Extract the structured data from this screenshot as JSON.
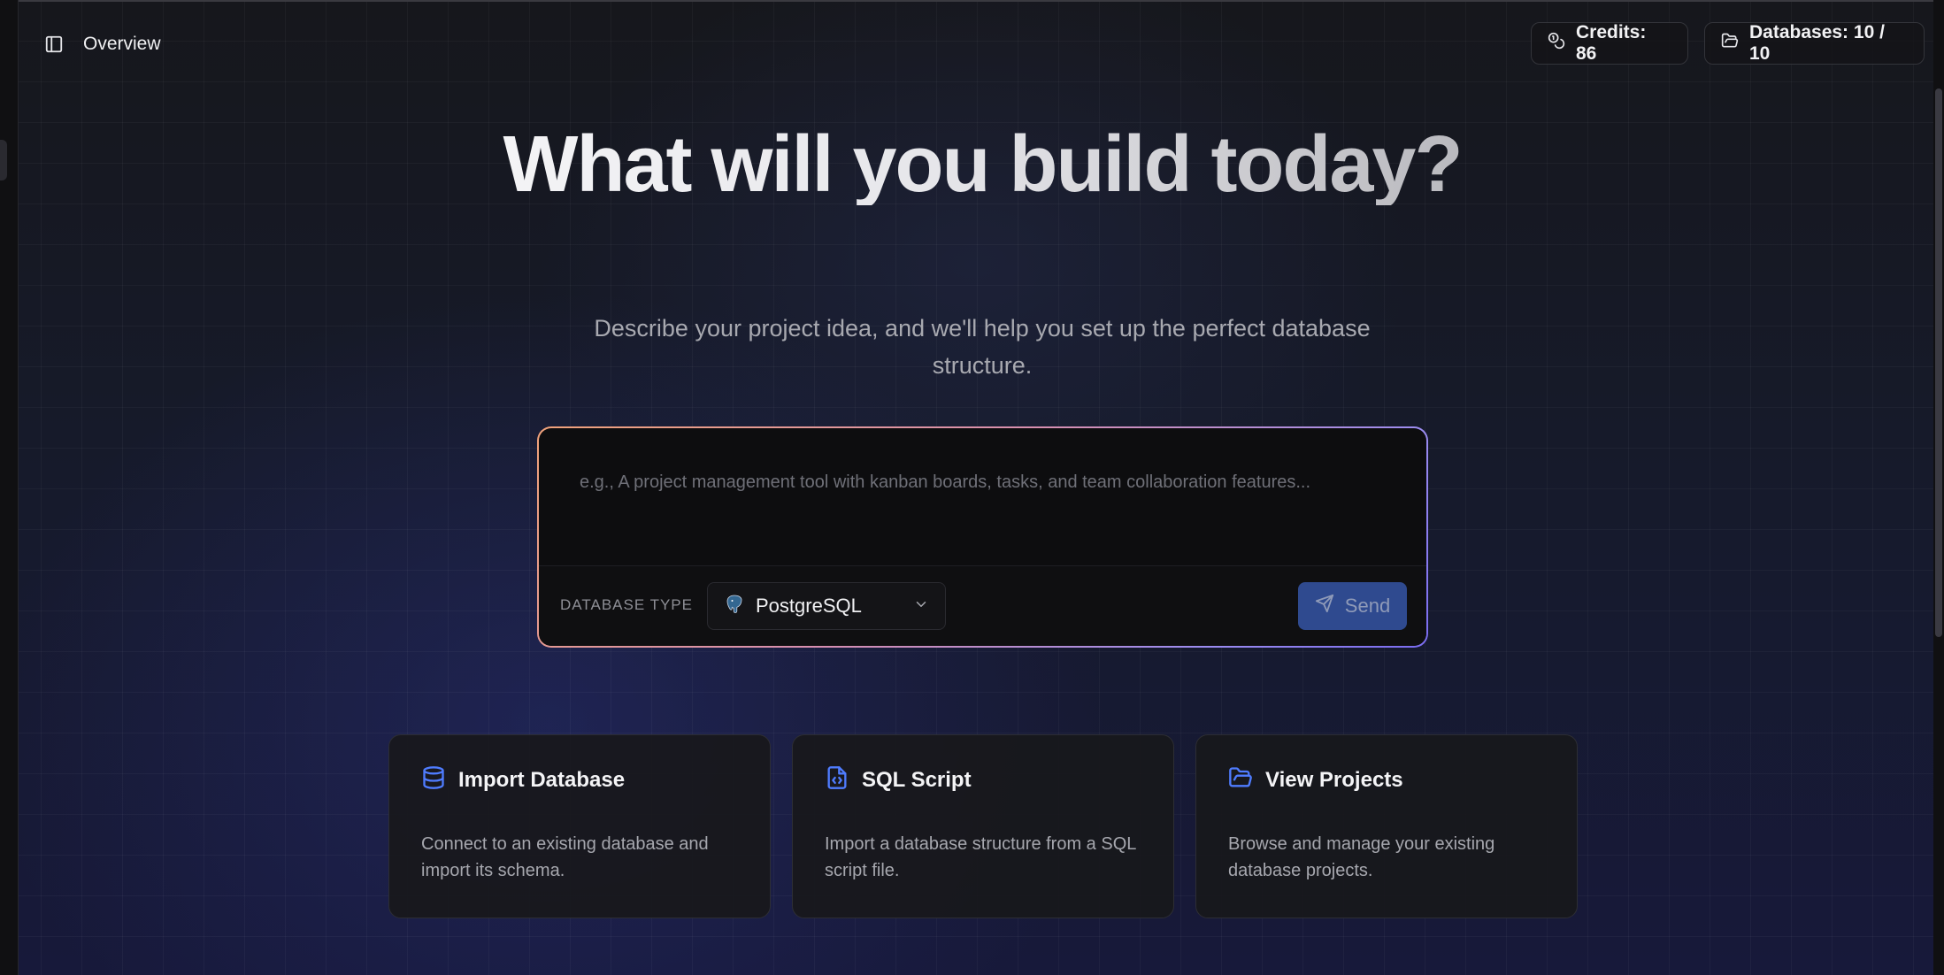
{
  "header": {
    "sidebar_toggle_icon": "sidebar-toggle-icon",
    "title": "Overview",
    "credits_label": "Credits: 86",
    "databases_label": "Databases: 10 / 10"
  },
  "hero": {
    "title": "What will you build today?",
    "subtitle": "Describe your project idea, and we'll help you set up the perfect database structure."
  },
  "prompt": {
    "placeholder": "e.g., A project management tool with kanban boards, tasks, and team collaboration features...",
    "database_type_label": "DATABASE TYPE",
    "database_type_value": "PostgreSQL",
    "send_label": "Send"
  },
  "cards": [
    {
      "icon": "database-icon",
      "title": "Import Database",
      "description": "Connect to an existing database and import its schema."
    },
    {
      "icon": "file-code-icon",
      "title": "SQL Script",
      "description": "Import a database structure from a SQL script file."
    },
    {
      "icon": "folder-open-icon",
      "title": "View Projects",
      "description": "Browse and manage your existing database projects."
    }
  ],
  "colors": {
    "accent_blue": "#4f7cff",
    "send_button": "#2f4a8f",
    "background": "#141416"
  }
}
